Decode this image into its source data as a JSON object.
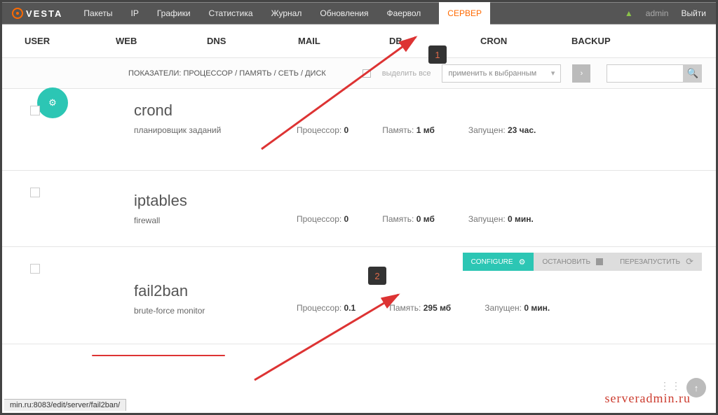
{
  "brand": "VESTA",
  "topnav": {
    "items": [
      "Пакеты",
      "IP",
      "Графики",
      "Статистика",
      "Журнал",
      "Обновления",
      "Фаервол",
      "СЕРВЕР"
    ],
    "active_index": 7
  },
  "user_menu": {
    "bell_icon": "bell",
    "admin": "admin",
    "logout": "Выйти"
  },
  "maintabs": [
    "USER",
    "WEB",
    "DNS",
    "MAIL",
    "DB",
    "CRON",
    "BACKUP"
  ],
  "toolbar": {
    "stats_line": "ПОКАЗАТЕЛИ: ПРОЦЕССОР / ПАМЯТЬ / СЕТЬ / ДИСК",
    "select_all": "выделить все",
    "apply_label": "применить к выбранным",
    "search_placeholder": ""
  },
  "labels": {
    "cpu": "Процессор:",
    "mem": "Память:",
    "uptime": "Запущен:"
  },
  "services": [
    {
      "name": "crond",
      "desc": "планировщик заданий",
      "cpu": "0",
      "mem": "1 мб",
      "uptime": "23 час."
    },
    {
      "name": "iptables",
      "desc": "firewall",
      "cpu": "0",
      "mem": "0 мб",
      "uptime": "0 мин."
    },
    {
      "name": "fail2ban",
      "desc": "brute-force monitor",
      "cpu": "0.1",
      "mem": "295 мб",
      "uptime": "0 мин."
    }
  ],
  "action_bar": {
    "configure": "CONFIGURE",
    "stop": "ОСТАНОВИТЬ",
    "restart": "ПЕРЕЗАПУСТИТЬ"
  },
  "annotations": {
    "badge1": "1",
    "badge2": "2"
  },
  "statusbar": "min.ru:8083/edit/server/fail2ban/",
  "watermark": "serveradmin.ru",
  "colors": {
    "accent": "#2cc6b4",
    "brand_orange": "#ff6a00",
    "anno_red": "#d33"
  }
}
